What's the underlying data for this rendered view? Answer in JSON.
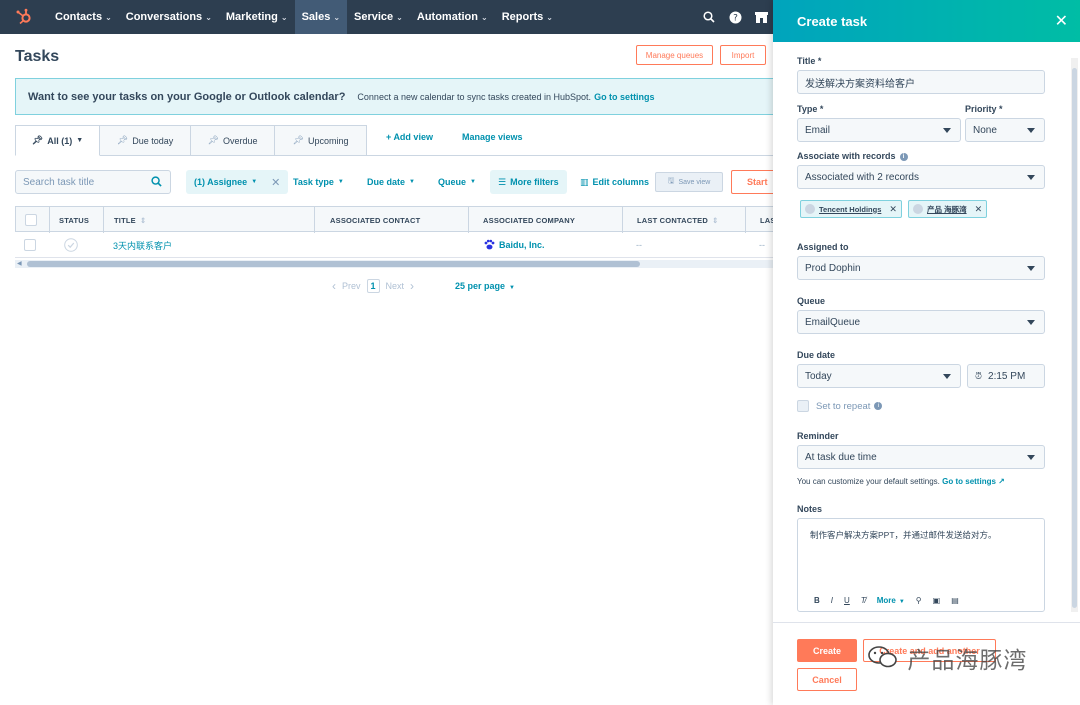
{
  "nav": {
    "items": [
      {
        "label": "Contacts"
      },
      {
        "label": "Conversations"
      },
      {
        "label": "Marketing"
      },
      {
        "label": "Sales"
      },
      {
        "label": "Service"
      },
      {
        "label": "Automation"
      },
      {
        "label": "Reports"
      }
    ],
    "active": "Sales"
  },
  "page": {
    "title": "Tasks",
    "manage_queues": "Manage queues",
    "import": "Import"
  },
  "banner": {
    "title": "Want to see your tasks on your Google or Outlook calendar?",
    "text": "Connect a new calendar to sync tasks created in HubSpot.",
    "link": "Go to settings"
  },
  "tabs": [
    {
      "label": "All (1)"
    },
    {
      "label": "Due today"
    },
    {
      "label": "Overdue"
    },
    {
      "label": "Upcoming"
    }
  ],
  "views": {
    "add": "Add view",
    "manage": "Manage views"
  },
  "filters": {
    "search_placeholder": "Search task title",
    "assignee": "(1) Assignee",
    "task_type": "Task type",
    "due_date": "Due date",
    "queue": "Queue",
    "more_filters": "More filters",
    "edit_columns": "Edit columns",
    "save_view": "Save view",
    "start": "Start"
  },
  "table": {
    "columns": [
      "STATUS",
      "TITLE",
      "ASSOCIATED CONTACT",
      "ASSOCIATED COMPANY",
      "LAST CONTACTED",
      "LAS"
    ],
    "rows": [
      {
        "title": "3天内联系客户",
        "contact": "",
        "company": "Baidu, Inc.",
        "last_contacted": "--",
        "last": "--"
      }
    ]
  },
  "pager": {
    "prev": "Prev",
    "page": "1",
    "next": "Next",
    "per_page": "25 per page"
  },
  "panel": {
    "title": "Create task",
    "title_label": "Title *",
    "title_value": "发送解决方案资料给客户",
    "type_label": "Type *",
    "type_value": "Email",
    "priority_label": "Priority *",
    "priority_value": "None",
    "associate_label": "Associate with records",
    "associate_value": "Associated with 2 records",
    "chips": [
      "Tencent Holdings",
      "产品 海豚湾"
    ],
    "assigned_label": "Assigned to",
    "assigned_value": "Prod Dophin",
    "queue_label": "Queue",
    "queue_value": "EmailQueue",
    "due_label": "Due date",
    "due_value": "Today",
    "time_value": "2:15 PM",
    "repeat_label": "Set to repeat",
    "reminder_label": "Reminder",
    "reminder_value": "At task due time",
    "customize_text": "You can customize your default settings.",
    "customize_link": "Go to settings",
    "notes_label": "Notes",
    "notes_value": "制作客户解决方案PPT，并通过邮件发送给对方。",
    "notes_more": "More",
    "create": "Create",
    "create_another": "Create and add another",
    "cancel": "Cancel"
  },
  "watermark": "产品海豚湾"
}
